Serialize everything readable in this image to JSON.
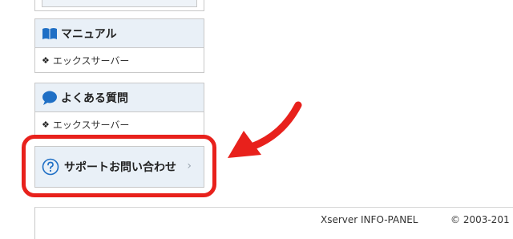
{
  "sidebar": {
    "manual": {
      "title": "マニュアル",
      "icon": "book-icon",
      "link": "エックスサーバー"
    },
    "faq": {
      "title": "よくある質問",
      "icon": "speech-bubble-icon",
      "link": "エックスサーバー"
    },
    "support": {
      "label": "サポートお問い合わせ",
      "icon": "question-circle-icon",
      "chevron": "›"
    },
    "bullet": "❖"
  },
  "annotation": {
    "highlight_color": "#e8211c",
    "arrow_icon": "red-arrow-icon"
  },
  "footer": {
    "brand": "Xserver INFO-PANEL",
    "copyright": "© 2003-201"
  },
  "colors": {
    "panel_header_bg": "#e9f0f7",
    "border": "#c8c8c8",
    "icon_blue": "#1f6fc5"
  }
}
